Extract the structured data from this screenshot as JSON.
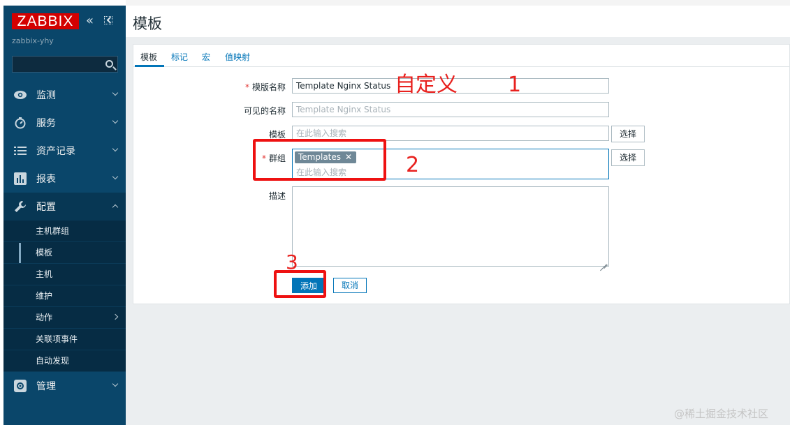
{
  "sidebar": {
    "logo": "ZABBIX",
    "server_name": "zabbix-yhy",
    "menu": [
      {
        "label": "监测"
      },
      {
        "label": "服务"
      },
      {
        "label": "资产记录"
      },
      {
        "label": "报表"
      },
      {
        "label": "配置"
      }
    ],
    "submenu": [
      {
        "label": "主机群组"
      },
      {
        "label": "模板"
      },
      {
        "label": "主机"
      },
      {
        "label": "维护"
      },
      {
        "label": "动作"
      },
      {
        "label": "关联项事件"
      },
      {
        "label": "自动发现"
      }
    ],
    "admin_label": "管理"
  },
  "page": {
    "title": "模板"
  },
  "tabs": [
    {
      "label": "模板"
    },
    {
      "label": "标记"
    },
    {
      "label": "宏"
    },
    {
      "label": "值映射"
    }
  ],
  "form": {
    "template_name_label": "模版名称",
    "template_name_value": "Template Nginx Status",
    "visible_name_label": "可见的名称",
    "visible_name_placeholder": "Template Nginx Status",
    "templates_label": "模板",
    "templates_placeholder": "在此输入搜索",
    "select_label": "选择",
    "groups_label": "群组",
    "groups_chip": "Templates",
    "groups_placeholder": "在此输入搜索",
    "description_label": "描述",
    "add_button": "添加",
    "cancel_button": "取消"
  },
  "annotations": {
    "custom_text": "自定义",
    "n1": "1",
    "n2": "2",
    "n3": "3",
    "color": "#ee1111"
  },
  "watermark": "@稀土掘金技术社区",
  "colors": {
    "sidebar_bg": "#0a466a",
    "logo_bg": "#d40000",
    "accent": "#0275b8",
    "page_bg": "#ebeef0"
  }
}
